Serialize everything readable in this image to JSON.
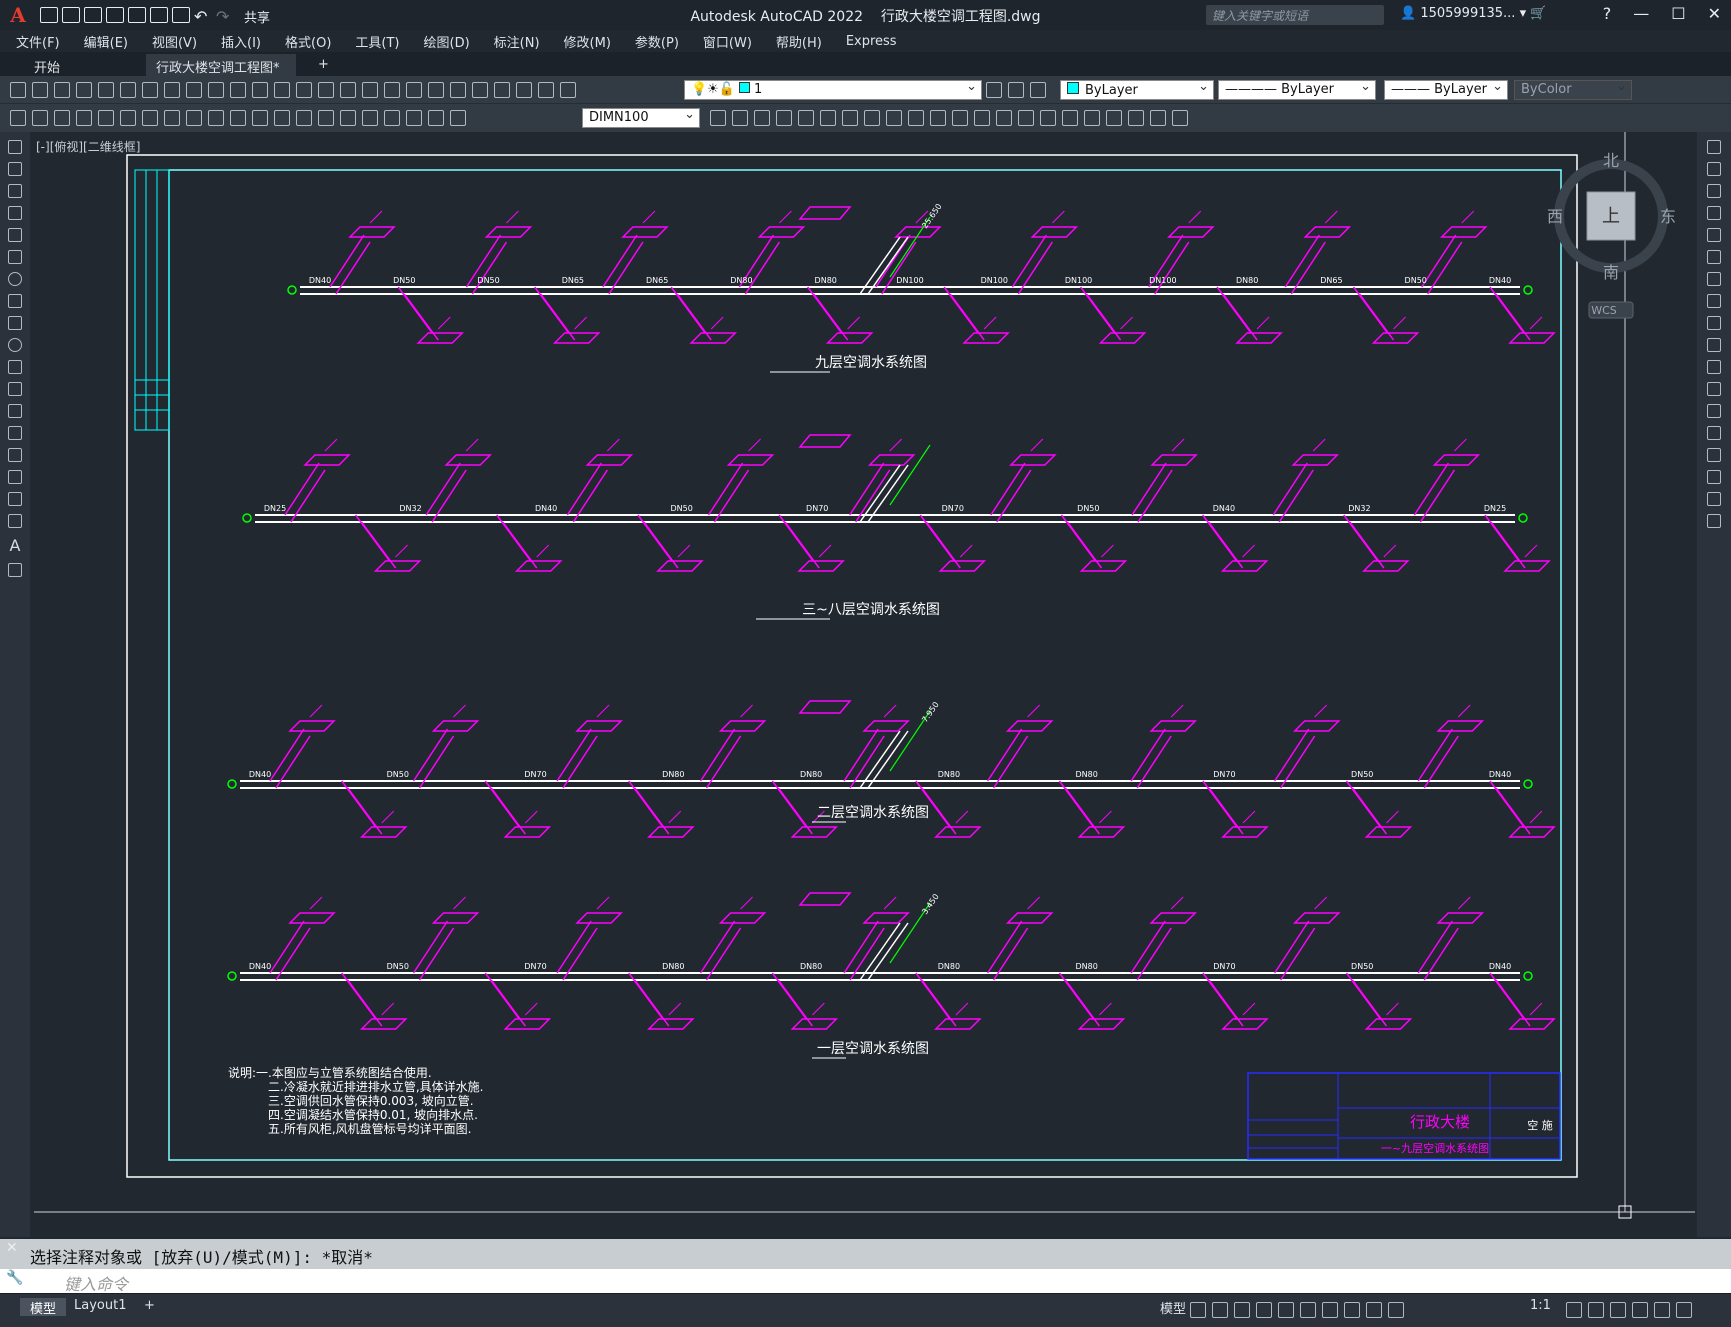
{
  "app": {
    "title": "Autodesk AutoCAD 2022",
    "file": "行政大楼空调工程图.dwg",
    "share": "共享",
    "search_placeholder": "键入关键字或短语",
    "user": "1505999135..."
  },
  "menu": [
    "文件(F)",
    "编辑(E)",
    "视图(V)",
    "插入(I)",
    "格式(O)",
    "工具(T)",
    "绘图(D)",
    "标注(N)",
    "修改(M)",
    "参数(P)",
    "窗口(W)",
    "帮助(H)",
    "Express"
  ],
  "tabs": {
    "start": "开始",
    "active": "行政大楼空调工程图*",
    "add": "+"
  },
  "toolbar": {
    "layer": "1",
    "color": "ByLayer",
    "linetype": "ByLayer",
    "lineweight": "ByLayer",
    "plotstyle": "ByColor",
    "dimstyle": "DIMN100"
  },
  "viewport_label": "[-][俯视][二维线框]",
  "viewcube": {
    "north": "北",
    "south": "南",
    "east": "东",
    "west": "西",
    "top": "上",
    "wcs": "WCS"
  },
  "drawing": {
    "sections": [
      {
        "title": "九层空调水系统图"
      },
      {
        "title": "三~八层空调水系统图"
      },
      {
        "title": "二层空调水系统图"
      },
      {
        "title": "一层空调水系统图"
      }
    ],
    "notes": [
      "说明:一.本图应与立管系统图结合使用.",
      "二.冷凝水就近排进排水立管,具体详水施.",
      "三.空调供回水管保持0.003, 坡向立管.",
      "四.空调凝结水管保持0.01, 坡向排水点.",
      "五.所有风柜,风机盘管标号均详平面图."
    ],
    "titleblock": {
      "project": "行政大楼",
      "drawing_name": "一~九层空调水系统图",
      "discipline": "空 施"
    },
    "pipe_labels_row1": [
      "DN40",
      "DN50",
      "DN50",
      "DN65",
      "DN65",
      "DN80",
      "DN80",
      "DN100",
      "DN100",
      "DN100",
      "DN100",
      "DN80",
      "DN65",
      "DN50",
      "DN40"
    ],
    "pipe_labels_row2": [
      "DN25",
      "DN32",
      "DN40",
      "DN50",
      "DN70",
      "DN70",
      "DN50",
      "DN40",
      "DN32",
      "DN25"
    ],
    "pipe_labels_row3": [
      "DN40",
      "DN50",
      "DN70",
      "DN80",
      "DN80",
      "DN80",
      "DN80",
      "DN70",
      "DN50",
      "DN40"
    ],
    "pipe_labels_row4": [
      "DN40",
      "DN50",
      "DN70",
      "DN80",
      "DN80",
      "DN80",
      "DN80",
      "DN70",
      "DN50",
      "DN40"
    ],
    "elevations": [
      "25.650",
      "7.950",
      "3.450"
    ]
  },
  "command": {
    "history": "选择注释对象或 [放弃(U)/模式(M)]: *取消*",
    "placeholder": "键入命令"
  },
  "status": {
    "model_tab": "模型",
    "layout_tab": "Layout1",
    "add": "+",
    "model": "模型",
    "scale": "1:1"
  },
  "colors": {
    "background": "#212830",
    "pipe": "#ffffff",
    "equipment": "#ff00ff",
    "valve": "#00ff00",
    "frame": "#7fffff",
    "titleblock": "#2a2aff"
  }
}
